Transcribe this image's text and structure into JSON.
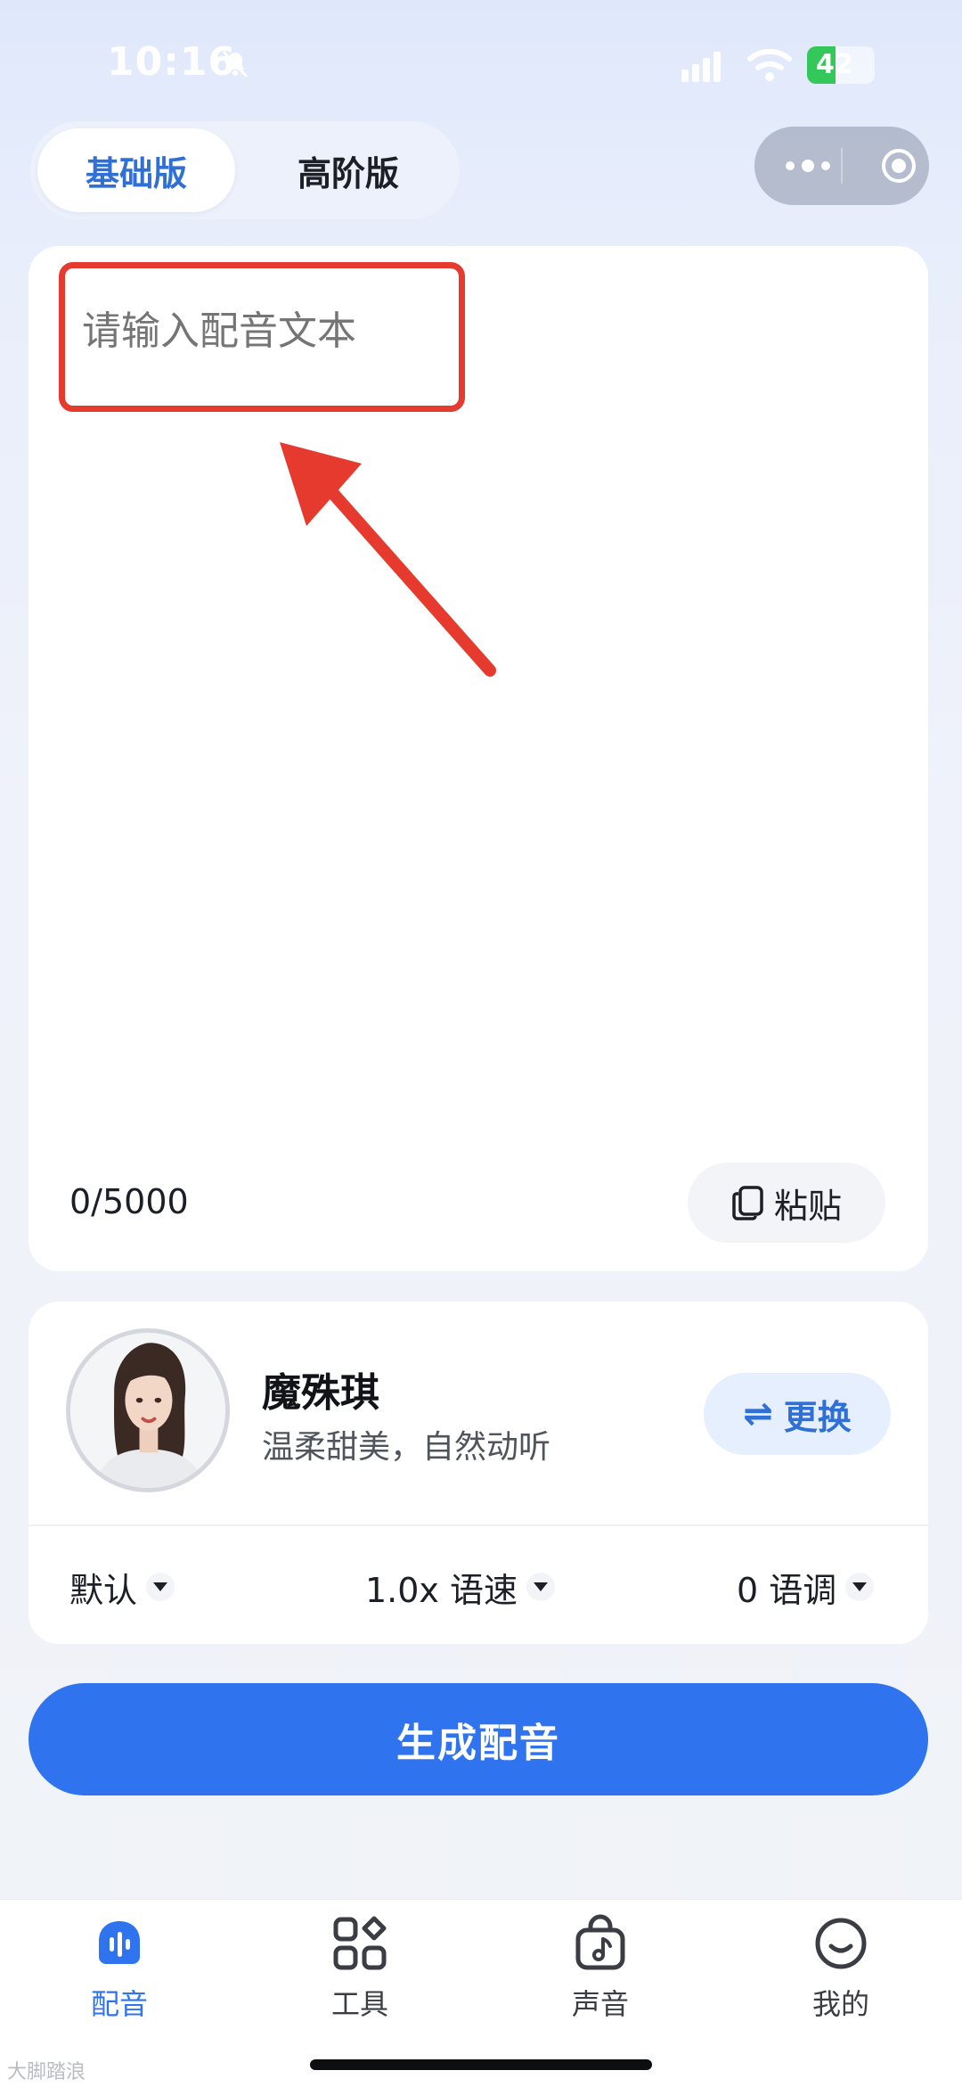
{
  "status_bar": {
    "time": "10:16",
    "battery_level": "42",
    "battery_percent": 42
  },
  "mode_tabs": [
    {
      "label": "基础版",
      "active": true
    },
    {
      "label": "高阶版",
      "active": false
    }
  ],
  "editor": {
    "placeholder": "请输入配音文本",
    "char_count": "0/5000",
    "paste_label": "粘贴"
  },
  "voice": {
    "name": "魔殊琪",
    "description": "温柔甜美，自然动听",
    "change_label": "更换",
    "options": {
      "style": "默认",
      "speed": "1.0x 语速",
      "pitch": "0 语调"
    }
  },
  "generate_label": "生成配音",
  "bottom_nav": [
    {
      "label": "配音",
      "icon": "waveform-icon",
      "active": true
    },
    {
      "label": "工具",
      "icon": "grid-icon",
      "active": false
    },
    {
      "label": "声音",
      "icon": "music-bag-icon",
      "active": false
    },
    {
      "label": "我的",
      "icon": "smile-icon",
      "active": false
    }
  ],
  "watermark": "大脚踏浪",
  "colors": {
    "accent": "#2f74ee",
    "annotation": "#e63a2e",
    "battery": "#34c759"
  }
}
